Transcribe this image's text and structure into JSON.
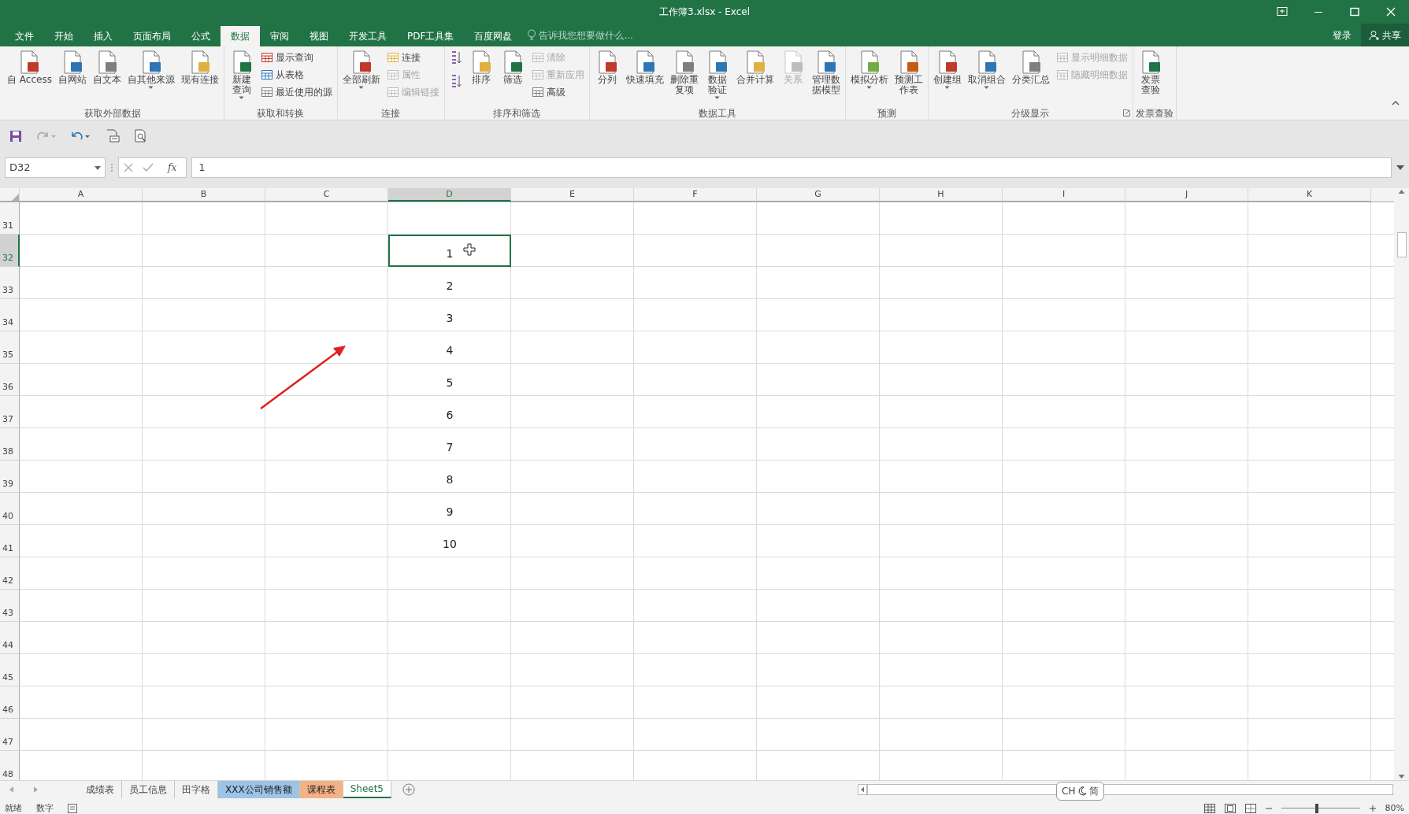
{
  "window": {
    "title": "工作簿3.xlsx - Excel"
  },
  "menu_tabs": [
    {
      "label": "文件",
      "selected": false
    },
    {
      "label": "开始",
      "selected": false
    },
    {
      "label": "插入",
      "selected": false
    },
    {
      "label": "页面布局",
      "selected": false
    },
    {
      "label": "公式",
      "selected": false
    },
    {
      "label": "数据",
      "selected": true
    },
    {
      "label": "审阅",
      "selected": false
    },
    {
      "label": "视图",
      "selected": false
    },
    {
      "label": "开发工具",
      "selected": false
    },
    {
      "label": "PDF工具集",
      "selected": false
    },
    {
      "label": "百度网盘",
      "selected": false
    }
  ],
  "tell_me": {
    "placeholder": "告诉我您想要做什么..."
  },
  "sign_in": "登录",
  "share": "共享",
  "ribbon_groups": [
    {
      "title": "获取外部数据",
      "dialog_launcher": false,
      "controls": [
        {
          "kind": "large",
          "label": "自 Access",
          "two_line": false,
          "dropdown": false,
          "disabled": false
        },
        {
          "kind": "large",
          "label": "自网站",
          "two_line": false,
          "dropdown": false,
          "disabled": false
        },
        {
          "kind": "large",
          "label": "自文本",
          "two_line": false,
          "dropdown": false,
          "disabled": false
        },
        {
          "kind": "large",
          "label": "自其他来源",
          "two_line": false,
          "dropdown": true,
          "disabled": false
        },
        {
          "kind": "large",
          "label": "现有连接",
          "two_line": false,
          "dropdown": false,
          "disabled": false
        }
      ]
    },
    {
      "title": "获取和转换",
      "dialog_launcher": false,
      "controls": [
        {
          "kind": "large",
          "label": "新建查询",
          "two_line": true,
          "dropdown": true,
          "disabled": false
        },
        {
          "kind": "small",
          "label": "显示查询",
          "disabled": false
        },
        {
          "kind": "small",
          "label": "从表格",
          "disabled": false
        },
        {
          "kind": "small",
          "label": "最近使用的源",
          "disabled": false
        }
      ]
    },
    {
      "title": "连接",
      "dialog_launcher": false,
      "controls": [
        {
          "kind": "large",
          "label": "全部刷新",
          "two_line": false,
          "dropdown": true,
          "disabled": false
        },
        {
          "kind": "small",
          "label": "连接",
          "disabled": false
        },
        {
          "kind": "small",
          "label": "属性",
          "disabled": true
        },
        {
          "kind": "small",
          "label": "编辑链接",
          "disabled": true
        }
      ]
    },
    {
      "title": "排序和筛选",
      "dialog_launcher": false,
      "controls": [
        {
          "kind": "icon_small",
          "disabled": false
        },
        {
          "kind": "icon_small",
          "disabled": false
        },
        {
          "kind": "large",
          "label": "排序",
          "two_line": false,
          "dropdown": false,
          "disabled": false
        },
        {
          "kind": "large",
          "label": "筛选",
          "two_line": false,
          "dropdown": false,
          "disabled": false
        },
        {
          "kind": "small",
          "label": "清除",
          "disabled": true
        },
        {
          "kind": "small",
          "label": "重新应用",
          "disabled": true
        },
        {
          "kind": "small",
          "label": "高级",
          "disabled": false
        }
      ]
    },
    {
      "title": "数据工具",
      "dialog_launcher": false,
      "controls": [
        {
          "kind": "large",
          "label": "分列",
          "two_line": false,
          "dropdown": false,
          "disabled": false
        },
        {
          "kind": "large",
          "label": "快速填充",
          "two_line": false,
          "dropdown": false,
          "disabled": false
        },
        {
          "kind": "large",
          "label": "删除重复项",
          "two_line": true,
          "dropdown": false,
          "disabled": false
        },
        {
          "kind": "large",
          "label": "数据验证",
          "two_line": true,
          "dropdown": true,
          "disabled": false
        },
        {
          "kind": "large",
          "label": "合并计算",
          "two_line": false,
          "dropdown": false,
          "disabled": false
        },
        {
          "kind": "large",
          "label": "关系",
          "two_line": false,
          "dropdown": false,
          "disabled": true
        },
        {
          "kind": "large",
          "label": "管理数据模型",
          "two_line": true,
          "dropdown": false,
          "disabled": false
        }
      ]
    },
    {
      "title": "预测",
      "dialog_launcher": false,
      "controls": [
        {
          "kind": "large",
          "label": "模拟分析",
          "two_line": false,
          "dropdown": true,
          "disabled": false
        },
        {
          "kind": "large",
          "label": "预测工作表",
          "two_line": true,
          "dropdown": false,
          "disabled": false
        }
      ]
    },
    {
      "title": "分级显示",
      "dialog_launcher": true,
      "controls": [
        {
          "kind": "large",
          "label": "创建组",
          "two_line": false,
          "dropdown": true,
          "disabled": false
        },
        {
          "kind": "large",
          "label": "取消组合",
          "two_line": false,
          "dropdown": true,
          "disabled": false
        },
        {
          "kind": "large",
          "label": "分类汇总",
          "two_line": false,
          "dropdown": false,
          "disabled": false
        },
        {
          "kind": "small",
          "label": "显示明细数据",
          "disabled": true
        },
        {
          "kind": "small",
          "label": "隐藏明细数据",
          "disabled": true
        }
      ]
    },
    {
      "title": "发票查验",
      "dialog_launcher": false,
      "controls": [
        {
          "kind": "large",
          "label": "发票查验",
          "two_line": true,
          "dropdown": false,
          "disabled": false
        }
      ]
    }
  ],
  "name_box": "D32",
  "function_button": "fx",
  "formula": "1",
  "columns": [
    {
      "label": "A",
      "selected": false
    },
    {
      "label": "B",
      "selected": false
    },
    {
      "label": "C",
      "selected": false
    },
    {
      "label": "D",
      "selected": true
    },
    {
      "label": "E",
      "selected": false
    },
    {
      "label": "F",
      "selected": false
    },
    {
      "label": "G",
      "selected": false
    },
    {
      "label": "H",
      "selected": false
    },
    {
      "label": "I",
      "selected": false
    },
    {
      "label": "J",
      "selected": false
    },
    {
      "label": "K",
      "selected": false
    }
  ],
  "rows": [
    {
      "header": "31",
      "selected": false
    },
    {
      "header": "32",
      "selected": true,
      "cells": [
        null,
        null,
        null,
        "1"
      ]
    },
    {
      "header": "33",
      "selected": false,
      "cells": [
        null,
        null,
        null,
        "2"
      ]
    },
    {
      "header": "34",
      "selected": false,
      "cells": [
        null,
        null,
        null,
        "3"
      ]
    },
    {
      "header": "35",
      "selected": false,
      "cells": [
        null,
        null,
        null,
        "4"
      ]
    },
    {
      "header": "36",
      "selected": false,
      "cells": [
        null,
        null,
        null,
        "5"
      ]
    },
    {
      "header": "37",
      "selected": false,
      "cells": [
        null,
        null,
        null,
        "6"
      ]
    },
    {
      "header": "38",
      "selected": false,
      "cells": [
        null,
        null,
        null,
        "7"
      ]
    },
    {
      "header": "39",
      "selected": false,
      "cells": [
        null,
        null,
        null,
        "8"
      ]
    },
    {
      "header": "40",
      "selected": false,
      "cells": [
        null,
        null,
        null,
        "9"
      ]
    },
    {
      "header": "41",
      "selected": false,
      "cells": [
        null,
        null,
        null,
        "10"
      ]
    },
    {
      "header": "42",
      "selected": false
    },
    {
      "header": "43",
      "selected": false
    },
    {
      "header": "44",
      "selected": false
    },
    {
      "header": "45",
      "selected": false
    },
    {
      "header": "46",
      "selected": false
    },
    {
      "header": "47",
      "selected": false
    },
    {
      "header": "48",
      "selected": false
    }
  ],
  "sheet_tabs": [
    {
      "label": "成绩表",
      "selected": false
    },
    {
      "label": "员工信息",
      "selected": false
    },
    {
      "label": "田字格",
      "selected": false
    },
    {
      "label": "XXX公司销售额",
      "selected": false,
      "color": "#9dc3e6"
    },
    {
      "label": "课程表",
      "selected": false,
      "color": "#f4b183"
    },
    {
      "label": "Sheet5",
      "selected": true
    }
  ],
  "ime": {
    "language": "CH",
    "mode": "简"
  },
  "status": {
    "ready": "就绪",
    "mode": "数字"
  },
  "zoom": {
    "label": "80%",
    "level": 0.45
  }
}
